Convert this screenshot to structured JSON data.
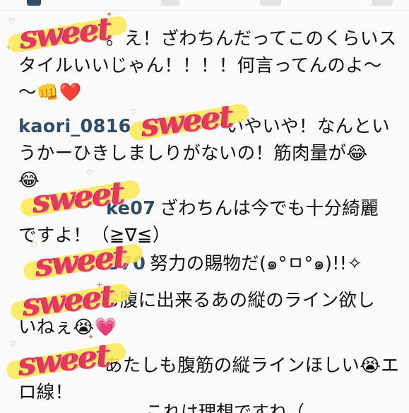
{
  "comments": [
    {
      "user": "",
      "line1": "。え！ざわちんだってこのくらいス",
      "line2": "タイルいいじゃん！！！！何言ってんのよ〜",
      "line3": "〜👊❤️"
    },
    {
      "user": "kaori_0816",
      "line1": "いやいや！なんとい",
      "line2": "うかーひきしましりがないの！筋肉量が😂",
      "line3": "😂"
    },
    {
      "user": "ke07",
      "line1": "ざわちんは今でも十分綺麗",
      "line2": "ですよ！（≧∇≦）"
    },
    {
      "user": "370",
      "line1": "努力の賜物だ(๑°ㅁ°๑)!!✧"
    },
    {
      "user": "",
      "line1": "お腹に出来るあの縦のライン欲し",
      "line2": "いねぇ😭💗"
    },
    {
      "user": "",
      "line1": "あたしも腹筋の縦ラインほしい😭エ",
      "line2": "ロ線！"
    }
  ],
  "bottom": {
    "user": "",
    "text": "これは理想ですね（"
  },
  "sticker_text": "sweet",
  "colors": {
    "username": "#2f4d67",
    "sticker": "#e23a5c",
    "highlight": "#fbe95a"
  }
}
